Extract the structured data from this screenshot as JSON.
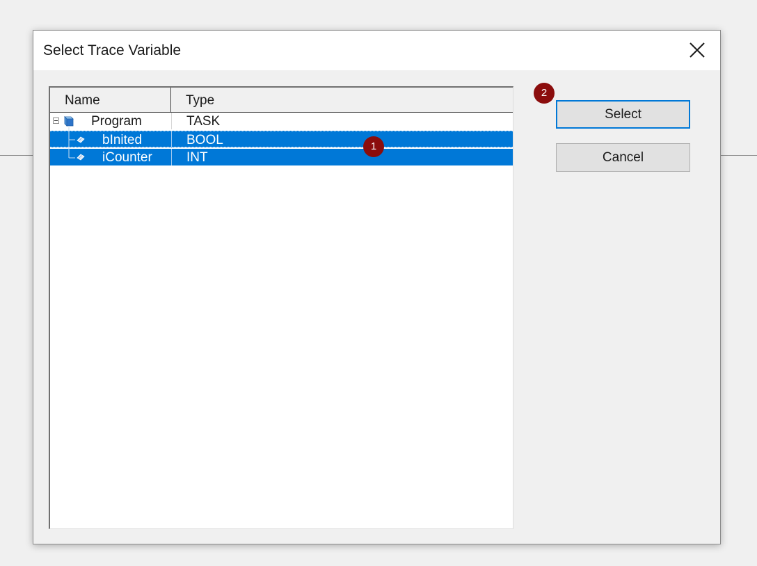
{
  "dialog": {
    "title": "Select Trace Variable"
  },
  "list": {
    "columns": [
      "Name",
      "Type"
    ],
    "rows": [
      {
        "name": "Program",
        "type": "TASK",
        "icon": "task-cube-icon",
        "selected": false
      },
      {
        "name": "bInited",
        "type": "BOOL",
        "icon": "variable-icon",
        "selected": true
      },
      {
        "name": "iCounter",
        "type": "INT",
        "icon": "variable-icon",
        "selected": true
      }
    ]
  },
  "buttons": {
    "select_label": "Select",
    "cancel_label": "Cancel"
  },
  "annotations": {
    "badge_1": "1",
    "badge_2": "2"
  },
  "colors": {
    "selection": "#0078d7",
    "badge": "#8b0d0d",
    "default_button_border": "#0078d7"
  }
}
